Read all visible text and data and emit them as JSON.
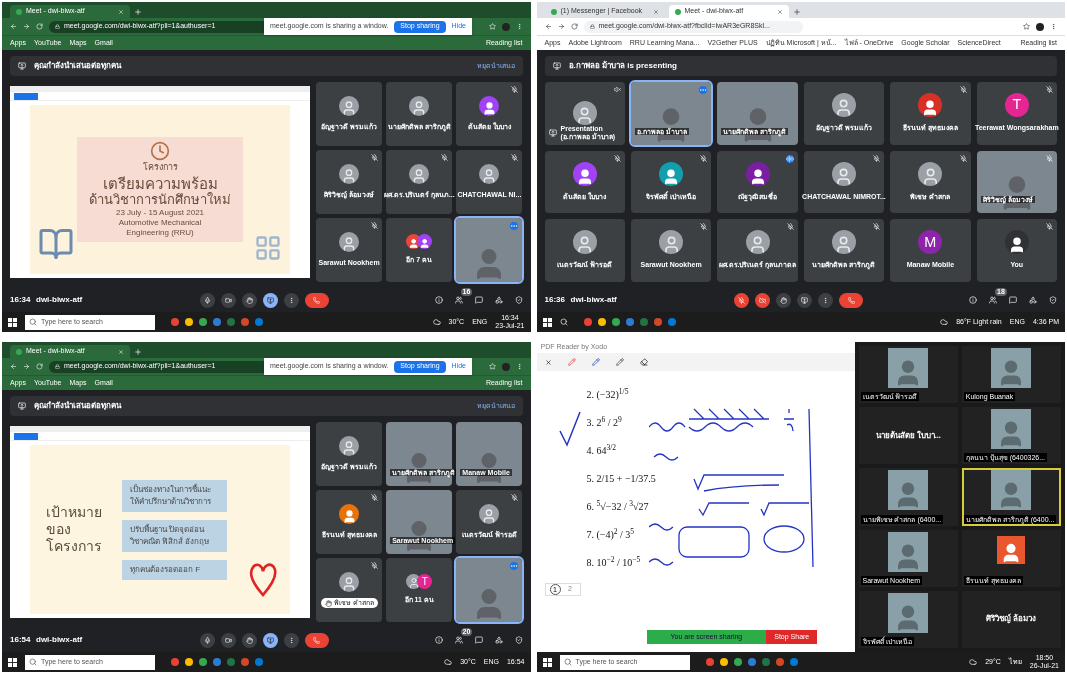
{
  "panels": [
    {
      "kind": "meet",
      "browser": {
        "tabs": [
          {
            "title": "Meet - dwi-biwx-atf",
            "selected": true
          }
        ],
        "url": "meet.google.com/dwi-biwx-atf?pli=1&authuser=1",
        "share_notice": {
          "text": "meet.google.com is sharing a window.",
          "stop": "Stop sharing",
          "hide": "Hide"
        },
        "bookmarks": [
          "Apps",
          "YouTube",
          "Maps",
          "Gmail"
        ],
        "reading_list": "Reading list"
      },
      "banner": {
        "text": "คุณกำลังนำเสนอต่อทุกคน",
        "action": "หยุดนำเสนอ"
      },
      "slide": {
        "kind": "cover",
        "lines": [
          "โครงการ",
          "เตรียมความพร้อม",
          "ด้านวิชาการนักศึกษาใหม่"
        ],
        "details": [
          "23 July - 15 August 2021",
          "Automotive Mechanical",
          "Engineering (RRU)"
        ]
      },
      "tiles": [
        {
          "kind": "photo",
          "name": "อัญฐาวดี พรมแก้ว",
          "muted": false,
          "highlighted": false
        },
        {
          "kind": "photo",
          "name": "นายศักดิพล สาริกภูติ",
          "muted": false,
          "highlighted": false
        },
        {
          "kind": "avatar",
          "color": "#a142f4",
          "name": "ต้นสัตย ใบบาง",
          "muted": true,
          "highlighted": false
        },
        {
          "kind": "photo",
          "name": "ศิริวิชญ์ ล้อมวงษ์",
          "muted": true,
          "highlighted": false
        },
        {
          "kind": "photo",
          "name": "ผศ.ดร.ปริเนตร์ กุลนภ...",
          "muted": true,
          "highlighted": false
        },
        {
          "kind": "photo",
          "name": "CHATCHAWAL NI...",
          "muted": true,
          "highlighted": false
        },
        {
          "kind": "photo",
          "name": "Sarawut Nookhem",
          "muted": true,
          "highlighted": false
        },
        {
          "kind": "group",
          "name": "อีก 7 คน",
          "muted": false,
          "highlighted": false,
          "avatars": [
            {
              "kind": "avatar",
              "color": "#e8453c"
            },
            {
              "kind": "avatar",
              "color": "#a142f4"
            }
          ]
        },
        {
          "kind": "video",
          "muted": false,
          "highlighted": true
        }
      ],
      "footer": {
        "time": "16:34",
        "code": "dwi-biwx-atf",
        "people": "16",
        "controls": [
          {
            "kind": "mic",
            "off": false,
            "active": false
          },
          {
            "kind": "camera",
            "off": false,
            "active": false
          },
          {
            "kind": "hand",
            "off": false,
            "active": false
          },
          {
            "kind": "present",
            "off": false,
            "active": true
          },
          {
            "kind": "more",
            "off": false,
            "active": false
          },
          {
            "kind": "leave",
            "off": false,
            "active": false
          }
        ]
      },
      "taskbar": {
        "search": "Type here to search",
        "weather": "30°C",
        "lang": "ENG",
        "time": "16:34",
        "date": "23-Jul-21"
      }
    },
    {
      "kind": "meet",
      "browser": {
        "tabs": [
          {
            "title": "(1) Messenger | Facebook",
            "selected": false
          },
          {
            "title": "Meet - dwi-biwx-atf",
            "selected": true
          }
        ],
        "url": "meet.google.com/dwi-biwx-atf?fbclid=IwAR3eGR8Skl...",
        "bookmarks": [
          "Apps",
          "Adobe Lightroom",
          "RRU Learning Mana...",
          "V2Gether PLUS",
          "ปฏิทิน Microsoft | หน้...",
          "ไฟล์ - OneDrive",
          "Google Scholar",
          "ScienceDirect"
        ],
        "reading_list": "Reading list"
      },
      "banner": {
        "text": "อ.กาพลอ ม้าบาล is presenting"
      },
      "tiles": [
        {
          "kind": "presentation",
          "name": "Presentation",
          "subname": "(อ.กาพลอ ม้าบาล)",
          "muted": true,
          "highlighted": false,
          "speaking": false
        },
        {
          "kind": "video",
          "name": "อ.กาพลอ ม้าบาล",
          "muted": false,
          "highlighted": true,
          "speaking": false
        },
        {
          "kind": "video",
          "name": "นายศักดิพล สาริกภูติ",
          "muted": false,
          "highlighted": false,
          "speaking": false
        },
        {
          "kind": "photo",
          "name": "อัญฐาวดี พรมแก้ว",
          "muted": false,
          "highlighted": false,
          "speaking": false
        },
        {
          "kind": "avatar",
          "color": "#d93025",
          "name": "ธีรนนท์ สุทธมงคล",
          "muted": true,
          "highlighted": false,
          "speaking": false
        },
        {
          "kind": "letter",
          "color": "#e52592",
          "initial": "T",
          "name": "Teerawat Wongsarakham",
          "muted": true,
          "highlighted": false,
          "speaking": false
        },
        {
          "kind": "avatar",
          "color": "#a142f4",
          "name": "ต้นสัตย ใบบาง",
          "muted": true,
          "highlighted": false,
          "speaking": false
        },
        {
          "kind": "avatar",
          "color": "#129eaf",
          "name": "จิรพัศดิ์ เป่าเหนือ",
          "muted": true,
          "highlighted": false,
          "speaking": false
        },
        {
          "kind": "avatar",
          "color": "#7b1fa2",
          "name": "ณัฐวุฒิ สมชื่อ",
          "muted": false,
          "highlighted": false,
          "speaking": true
        },
        {
          "kind": "photo",
          "name": "CHATCHAWAL NIMROT...",
          "muted": true,
          "highlighted": false,
          "speaking": false
        },
        {
          "kind": "photo",
          "name": "พิเชษ คำสกล",
          "muted": true,
          "highlighted": false,
          "speaking": false
        },
        {
          "kind": "video",
          "name": "ศิริวิชญ์ ล้อมวงษ์",
          "muted": true,
          "highlighted": false,
          "speaking": false
        },
        {
          "kind": "photo",
          "name": "เนตรวัฒน์ ฟ้ารอดี",
          "muted": false,
          "highlighted": false,
          "speaking": false
        },
        {
          "kind": "photo",
          "name": "Sarawut Nookhem",
          "muted": true,
          "highlighted": false,
          "speaking": false
        },
        {
          "kind": "photo",
          "name": "ผศ.ดร.ปริเนตร์ กุลนภาดล",
          "muted": true,
          "highlighted": false,
          "speaking": false
        },
        {
          "kind": "photo",
          "name": "นายศักดิพล สาริกภูติ",
          "muted": true,
          "highlighted": false,
          "speaking": false
        },
        {
          "kind": "letter",
          "color": "#8e24aa",
          "initial": "M",
          "name": "Manaw Mobile",
          "muted": false,
          "highlighted": false,
          "speaking": false
        },
        {
          "kind": "avatar",
          "color": "#303134",
          "name": "You",
          "muted": true,
          "highlighted": false,
          "speaking": false
        }
      ],
      "footer": {
        "time": "16:36",
        "code": "dwi-biwx-atf",
        "people": "18",
        "controls": [
          {
            "kind": "mic",
            "off": true,
            "active": false
          },
          {
            "kind": "camera",
            "off": true,
            "active": false
          },
          {
            "kind": "hand",
            "off": false,
            "active": false
          },
          {
            "kind": "present",
            "off": false,
            "active": false
          },
          {
            "kind": "more",
            "off": false,
            "active": false
          },
          {
            "kind": "leave",
            "off": false,
            "active": false
          }
        ]
      },
      "taskbar": {
        "weather": "86°F Light rain",
        "lang": "ENG",
        "time": "4:36 PM"
      }
    },
    {
      "kind": "meet",
      "browser": {
        "tabs": [
          {
            "title": "Meet - dwi-biwx-atf",
            "selected": true
          }
        ],
        "url": "meet.google.com/dwi-biwx-atf?pli=1&authuser=1",
        "share_notice": {
          "text": "meet.google.com is sharing a window.",
          "stop": "Stop sharing",
          "hide": "Hide"
        },
        "bookmarks": [
          "Apps",
          "YouTube",
          "Maps",
          "Gmail"
        ],
        "reading_list": "Reading list"
      },
      "banner": {
        "text": "คุณกำลังนำเสนอต่อทุกคน",
        "action": "หยุดนำเสนอ"
      },
      "slide": {
        "kind": "goals",
        "lines": [
          "เป้าหมาย",
          "ของ",
          "โครงการ"
        ],
        "details": [
          "เป็นช่องทางในการชี้แนะ ให้คำปรึกษาด้านวิชาการ",
          "ปรับพื้นฐาน ปิดจุดอ่อน วิชาคณิต ฟิสิกส์ อังกฤษ",
          "ทุกคนต้องรอดออก F"
        ]
      },
      "tiles": [
        {
          "kind": "photo",
          "name": "อัญฐาวดี พรมแก้ว",
          "muted": false,
          "highlighted": false,
          "hand_raised": false
        },
        {
          "kind": "video",
          "name": "นายศักดิพล สาริกภูติ",
          "muted": false,
          "highlighted": false,
          "hand_raised": false
        },
        {
          "kind": "video",
          "name": "Manaw Mobile",
          "muted": false,
          "highlighted": false,
          "hand_raised": false
        },
        {
          "kind": "avatar",
          "color": "#e8710a",
          "name": "ธีรนนท์ สุทธมงคล",
          "muted": true,
          "highlighted": false,
          "hand_raised": false
        },
        {
          "kind": "video",
          "name": "Sarawut Nookhem",
          "muted": false,
          "highlighted": false,
          "hand_raised": false
        },
        {
          "kind": "photo",
          "name": "เนตรวัฒน์ ฟ้ารอดี",
          "muted": true,
          "highlighted": false,
          "hand_raised": false
        },
        {
          "kind": "photo",
          "name": "พิเชษ คำสกล",
          "muted": true,
          "highlighted": false,
          "hand_raised": true
        },
        {
          "kind": "group",
          "name": "อีก 11 คน",
          "muted": false,
          "highlighted": false,
          "hand_raised": false,
          "avatars": [
            {
              "kind": "photo"
            },
            {
              "kind": "letter",
              "initial": "T",
              "color": "#e52592"
            }
          ]
        },
        {
          "kind": "video",
          "muted": false,
          "highlighted": true,
          "hand_raised": false
        }
      ],
      "footer": {
        "time": "16:54",
        "code": "dwi-biwx-atf",
        "people": "20",
        "controls": [
          {
            "kind": "mic",
            "off": false,
            "active": false
          },
          {
            "kind": "camera",
            "off": false,
            "active": false
          },
          {
            "kind": "hand",
            "off": false,
            "active": false
          },
          {
            "kind": "present",
            "off": false,
            "active": true
          },
          {
            "kind": "more",
            "off": false,
            "active": false
          },
          {
            "kind": "leave",
            "off": false,
            "active": false
          }
        ]
      },
      "taskbar": {
        "search": "Type here to search",
        "weather": "30°C",
        "lang": "ENG",
        "time": "16:54"
      }
    },
    {
      "kind": "zoom",
      "reader": {
        "title": "PDF Reader by Xodo",
        "problems": [
          "2. (−32)$^{1/5}$",
          "3. 2$^{6}$ / 2$^{9}$",
          "4. 64$^{3/2}$",
          "5. 2/15 + −1/37.5",
          "6. $^{5}$√−32 / $^{3}$√27",
          "7. (−4)$^{2}$ / 3$^{5}$",
          "8. 10$^{−2}$ / 10$^{−5}$"
        ],
        "pages": [
          {
            "label": "1",
            "selected": true
          },
          {
            "label": "2",
            "selected": false
          }
        ]
      },
      "share_bar": {
        "text": "You are screen sharing",
        "stop": "Stop Share"
      },
      "gallery": [
        {
          "kind": "video",
          "name": "เนตรวัฒน์ ฟ้ารอดี",
          "highlighted": false
        },
        {
          "kind": "video",
          "name": "Kulong Buanak",
          "highlighted": false
        },
        {
          "kind": "label",
          "name": "นายต้นสัตย ใบบา...",
          "highlighted": false
        },
        {
          "kind": "video",
          "name": "กุลนนา ปุ้นสุข (6400326...",
          "highlighted": false
        },
        {
          "kind": "video",
          "name": "นายพิเชษ คำสกล (6400...",
          "highlighted": false
        },
        {
          "kind": "video",
          "name": "นายศักดิพล สาริกภูติ (6400...",
          "highlighted": true
        },
        {
          "kind": "video",
          "name": "Sarawut Nookhem",
          "highlighted": false
        },
        {
          "kind": "avatar",
          "name": "ธีรนนท์ สุทธมงคล",
          "highlighted": false
        },
        {
          "kind": "video",
          "name": "จิรพัศดิ์ เป่าเหนือ",
          "highlighted": false
        },
        {
          "kind": "label",
          "name": "ศิริวิชญ์ ล้อมวง",
          "highlighted": false
        }
      ],
      "taskbar": {
        "search": "Type here to search",
        "weather": "29°C",
        "lang": "ไทย",
        "time": "18:50",
        "date": "26-Jul-21"
      }
    }
  ]
}
